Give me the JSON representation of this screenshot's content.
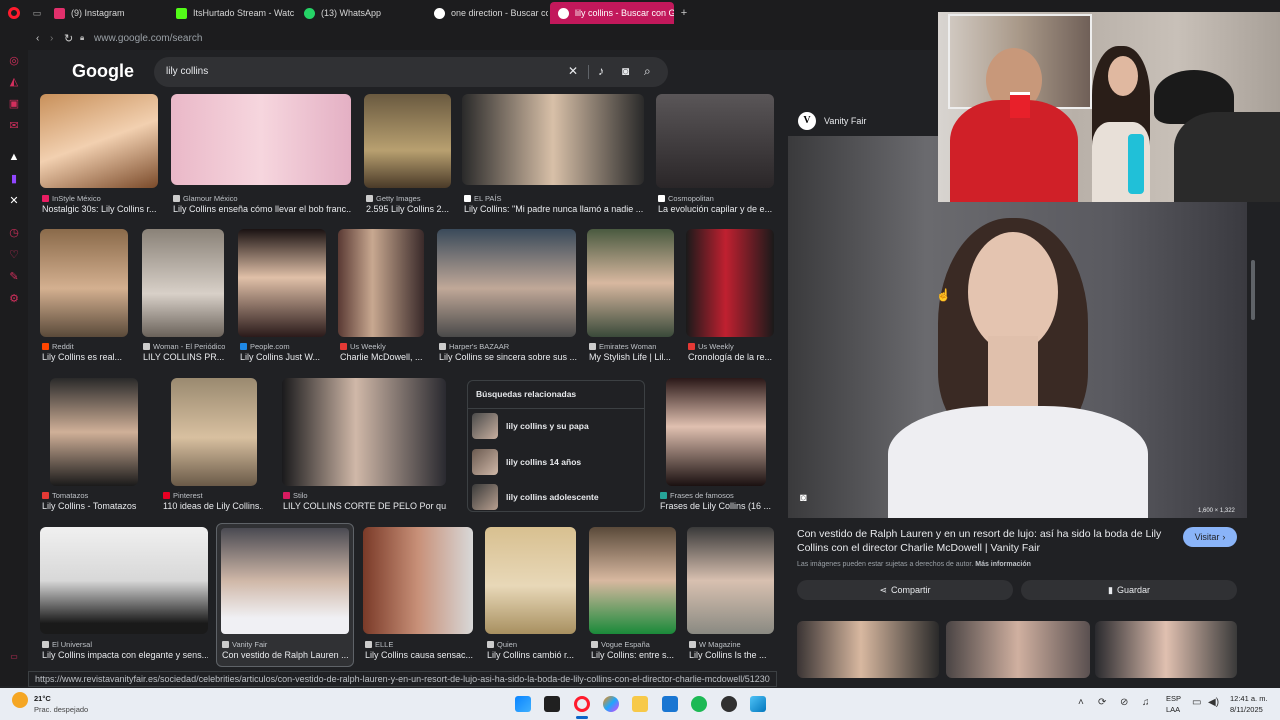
{
  "tabs": [
    {
      "label": "(9) Instagram",
      "color": "#e1306c"
    },
    {
      "label": "ItsHurtado Stream - Watc",
      "color": "#53fc18"
    },
    {
      "label": "(13) WhatsApp",
      "color": "#25d366"
    },
    {
      "label": "one direction - Buscar co",
      "color": "#ffffff"
    },
    {
      "label": "lily collins - Buscar con G",
      "color": "#ffffff"
    }
  ],
  "address": {
    "url": "www.google.com/search"
  },
  "google": {
    "logo": "Google",
    "query": "lily collins"
  },
  "row1": [
    {
      "source": "InStyle México",
      "title": "Nostalgic 30s: Lily Collins r...",
      "color": "#d6a889"
    },
    {
      "source": "Glamour México",
      "title": "Lily Collins enseña cómo llevar el bob franc...",
      "color": "#e8b8c8"
    },
    {
      "source": "Getty Images",
      "title": "2.595 Lily Collins 2...",
      "color": "#8a7a62"
    },
    {
      "source": "EL PAÍS",
      "title": "Lily Collins: \"Mi padre nunca llamó a nadie ...",
      "color": "#5a5650"
    },
    {
      "source": "Cosmopolitan",
      "title": "La evolución capilar y de e...",
      "color": "#4a4548"
    }
  ],
  "row2": [
    {
      "source": "Reddit",
      "title": "Lily Collins es real...",
      "color": "#7a6a5a"
    },
    {
      "source": "Woman - El Periódico",
      "title": "LILY COLLINS PR...",
      "color": "#9a9088"
    },
    {
      "source": "People.com",
      "title": "Lily Collins Just W...",
      "color": "#3a2c28"
    },
    {
      "source": "Us Weekly",
      "title": "Charlie McDowell, ...",
      "color": "#6a4a44"
    },
    {
      "source": "Harper's BAZAAR",
      "title": "Lily Collins se sincera sobre sus ...",
      "color": "#5c5a5c"
    },
    {
      "source": "Emirates Woman",
      "title": "My Stylish Life | Lil...",
      "color": "#6a7050"
    },
    {
      "source": "Us Weekly",
      "title": "Cronología de la re...",
      "color": "#4a2a30"
    }
  ],
  "row3": [
    {
      "source": "Tomatazos",
      "title": "Lily Collins - Tomatazos",
      "color": "#3a3030"
    },
    {
      "source": "Pinterest",
      "title": "110 ideas de Lily Collins...",
      "color": "#8a7860"
    },
    {
      "source": "Stilo",
      "title": "LILY COLLINS CORTE DE PELO Por qu...",
      "color": "#2a2a2c"
    },
    {
      "source": "Frases de famosos",
      "title": "Frases de Lily Collins (16 ...",
      "color": "#3a2424"
    }
  ],
  "related": {
    "heading": "Búsquedas relacionadas",
    "items": [
      "lily collins y su papa",
      "lily collins 14 años",
      "lily collins adolescente"
    ]
  },
  "row4": [
    {
      "source": "El Universal",
      "title": "Lily Collins impacta con elegante y sens...",
      "color": "#e8e8e8"
    },
    {
      "source": "Vanity Fair",
      "title": "Con vestido de Ralph Lauren ...",
      "color": "#7a7078"
    },
    {
      "source": "ELLE",
      "title": "Lily Collins causa sensac...",
      "color": "#6a3a2c"
    },
    {
      "source": "Quien",
      "title": "Lily Collins cambió r...",
      "color": "#c8b888"
    },
    {
      "source": "Vogue España",
      "title": "Lily Collins: entre s...",
      "color": "#6a5a4a"
    },
    {
      "source": "W Magazine",
      "title": "Lily Collins Is the ...",
      "color": "#8a8a82"
    }
  ],
  "panel": {
    "source": "Vanity Fair",
    "dimensions": "1,600 × 1,322",
    "title": "Con vestido de Ralph Lauren y en un resort de lujo: así ha sido la boda de Lily Collins con el director Charlie McDowell | Vanity Fair",
    "visit_label": "Visitar",
    "copyright_text": "Las imágenes pueden estar sujetas a derechos de autor.",
    "more_info": "Más información",
    "share_label": "Compartir",
    "save_label": "Guardar"
  },
  "status_url": "https://www.revistavanityfair.es/sociedad/celebrities/articulos/con-vestido-de-ralph-lauren-y-en-un-resort-de-lujo-asi-ha-sido-la-boda-de-lily-collins-con-el-director-charlie-mcdowell/51230",
  "taskbar": {
    "temp": "21°C",
    "weather": "Prac. despejado",
    "lang1": "ESP",
    "lang2": "LAA",
    "time": "12:41 a. m.",
    "date": "8/11/2025"
  }
}
